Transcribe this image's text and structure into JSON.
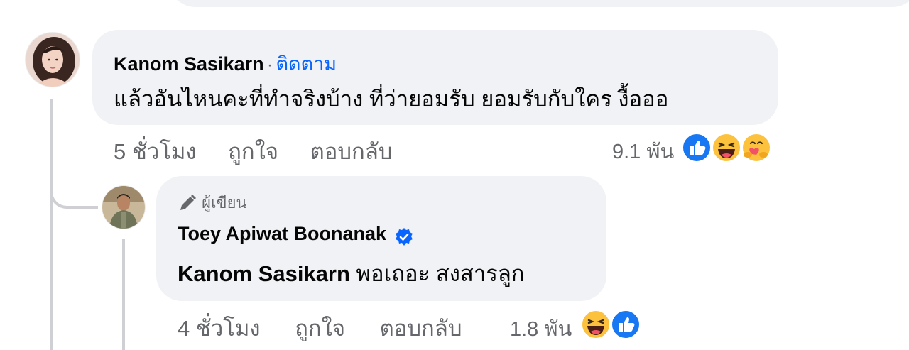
{
  "comments": [
    {
      "author": "Kanom Sasikarn",
      "separator": "·",
      "follow_label": "ติดตาม",
      "text": "แล้วอันไหนคะที่ทำจริงบ้าง ที่ว่ายอมรับ ยอมรับกับใคร งื้อออ",
      "time": "5 ชั่วโมง",
      "like_label": "ถูกใจ",
      "reply_label": "ตอบกลับ",
      "reaction_count": "9.1 พัน",
      "reactions": [
        "like-icon",
        "haha-icon",
        "care-icon"
      ]
    },
    {
      "author_badge": "ผู้เขียน",
      "author": "Toey Apiwat Boonanak",
      "verified": true,
      "mention": "Kanom Sasikarn",
      "text": " พอเถอะ สงสารลูก",
      "time": "4 ชั่วโมง",
      "like_label": "ถูกใจ",
      "reply_label": "ตอบกลับ",
      "reaction_count": "1.8 พัน",
      "reactions": [
        "haha-icon",
        "like-icon"
      ]
    }
  ],
  "colors": {
    "bubble": "#f0f2f5",
    "link": "#0866ff",
    "secondary_text": "#65676b",
    "thread_line": "#ced0d4"
  }
}
